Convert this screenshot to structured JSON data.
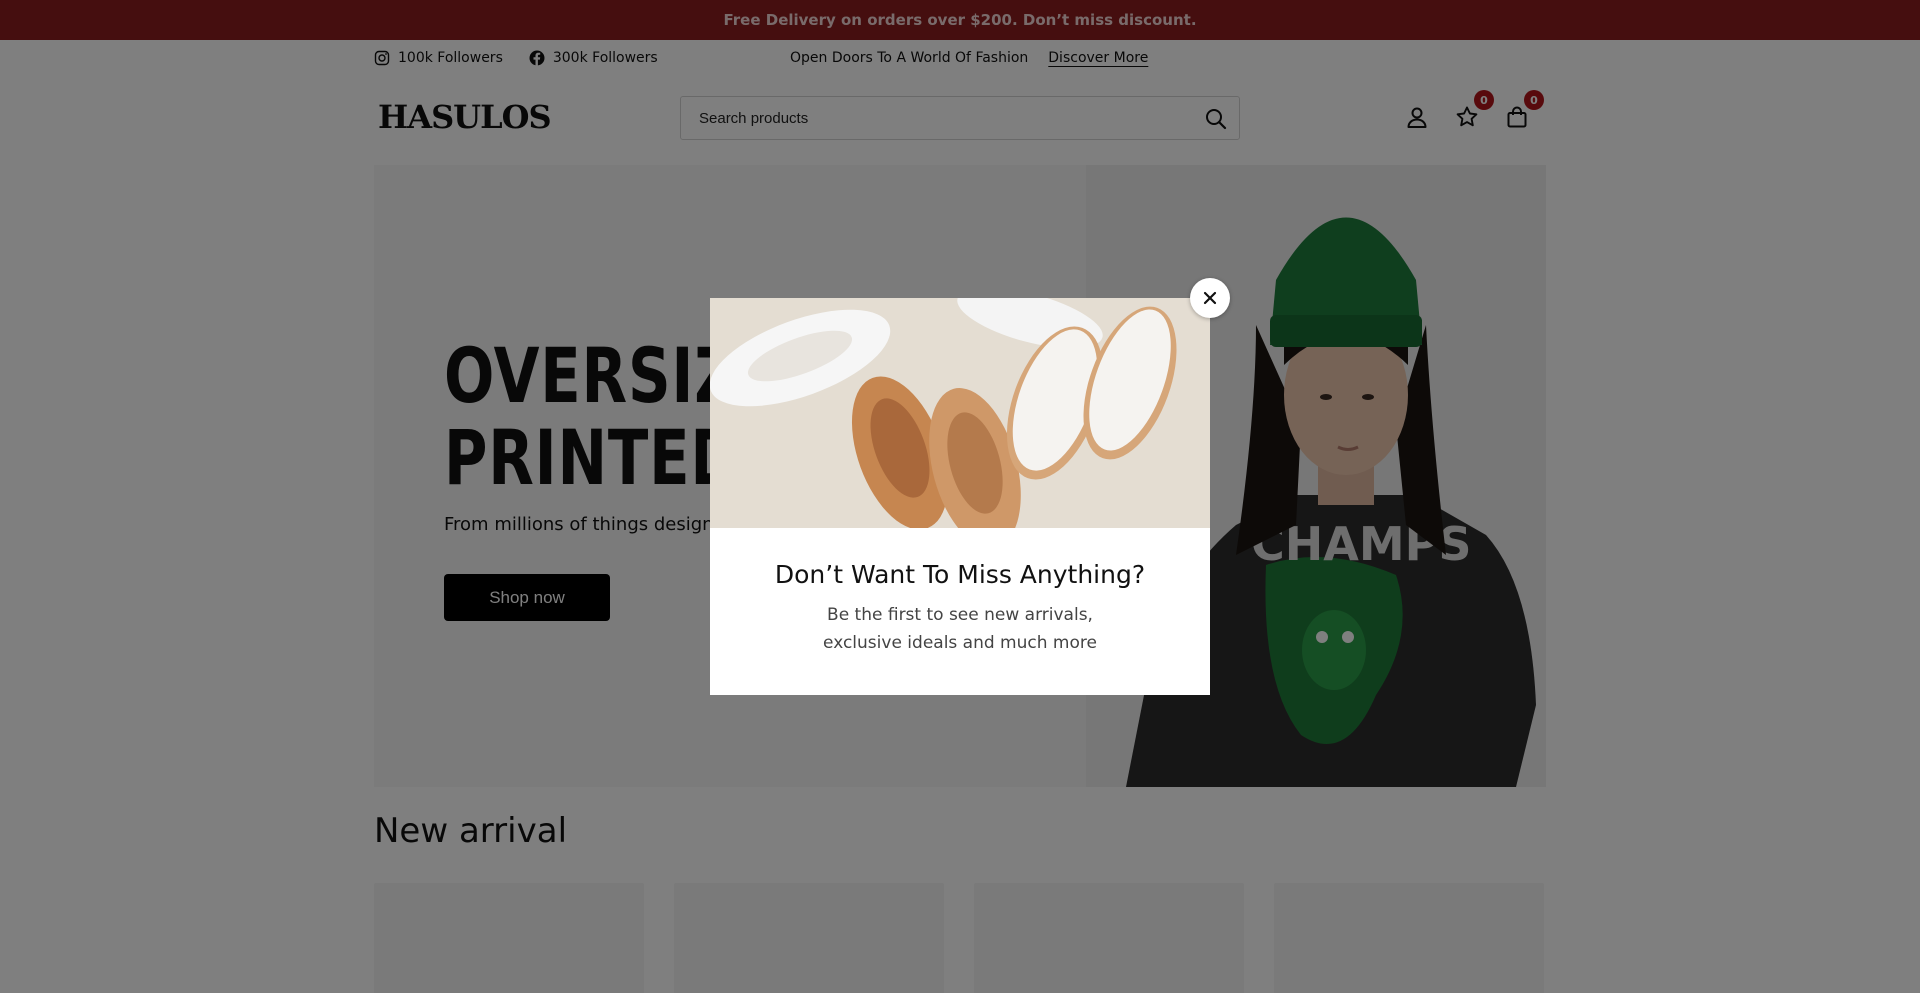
{
  "announcement": {
    "text": "Free Delivery on orders over $200. Don’t miss discount."
  },
  "topbar": {
    "social": [
      {
        "icon": "instagram-icon",
        "label": "100k Followers"
      },
      {
        "icon": "facebook-icon",
        "label": "300k Followers"
      }
    ],
    "promo_text": "Open Doors To A World Of Fashion",
    "promo_link": "Discover More"
  },
  "header": {
    "logo": "HASULOS",
    "search_placeholder": "Search products",
    "icons": {
      "account": "user-icon",
      "wishlist": "star-icon",
      "wishlist_count": "0",
      "cart": "shopping-bag-icon",
      "cart_count": "0"
    }
  },
  "hero": {
    "title_line1": "OVERSIZED",
    "title_line2": "PRINTED T-",
    "subtitle": "From millions of things designed",
    "button": "Shop now"
  },
  "section": {
    "title": "New arrival"
  },
  "modal": {
    "title": "Don’t Want To Miss Anything?",
    "text": "Be the first to see new arrivals, exclusive ideals and much more",
    "close_icon": "close-icon"
  },
  "colors": {
    "announcement_bg": "#8b1c1f",
    "badge": "#b1141a",
    "button": "#000000"
  }
}
